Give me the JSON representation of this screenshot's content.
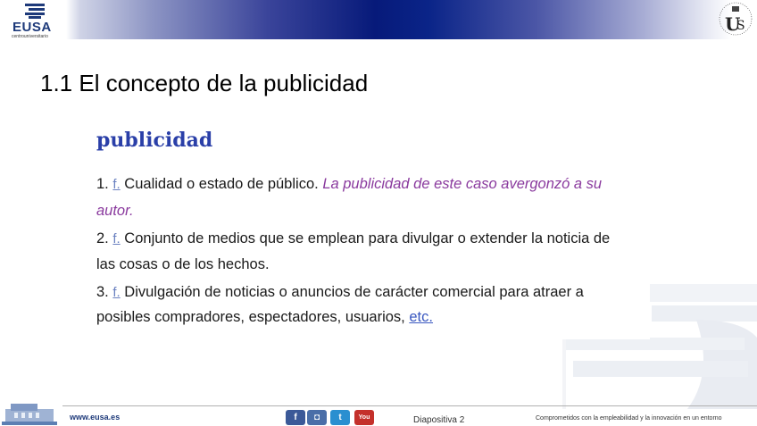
{
  "header": {
    "logo_text": "EUSA",
    "logo_subtext": "centrouniversitario",
    "seal_label": "UNIVERSIDAD DE SEVILLA"
  },
  "slide": {
    "title": "1.1 El concepto de la publicidad"
  },
  "dictionary": {
    "headword": "publicidad",
    "definitions": [
      {
        "num": "1.",
        "abbr": "f.",
        "text": "Cualidad o estado de público.",
        "example_line1": "La publicidad de este caso avergonzó a su",
        "example_line2": "autor."
      },
      {
        "num": "2.",
        "abbr": "f.",
        "text_line1": "Conjunto de medios que se emplean para divulgar o extender la noticia de",
        "text_line2": "las cosas o de los hechos."
      },
      {
        "num": "3.",
        "abbr": "f.",
        "text_line1": "Divulgación de noticias o anuncios de carácter comercial para atraer a",
        "text_line2": "posibles compradores, espectadores, usuarios,",
        "link": "etc."
      }
    ]
  },
  "footer": {
    "url": "www.eusa.es",
    "social": [
      {
        "name": "facebook-icon",
        "glyph": "f",
        "color": "#3b5998"
      },
      {
        "name": "photo-icon",
        "glyph": "◘",
        "color": "#4a6ea8"
      },
      {
        "name": "twitter-icon",
        "glyph": "t",
        "color": "#2a8fd0"
      },
      {
        "name": "youtube-icon",
        "glyph": "You",
        "color": "#c4302b"
      }
    ],
    "slide_number": "Diapositiva 2",
    "tagline": "Comprometidos con la empleabilidad y la innovación en un entorno"
  }
}
